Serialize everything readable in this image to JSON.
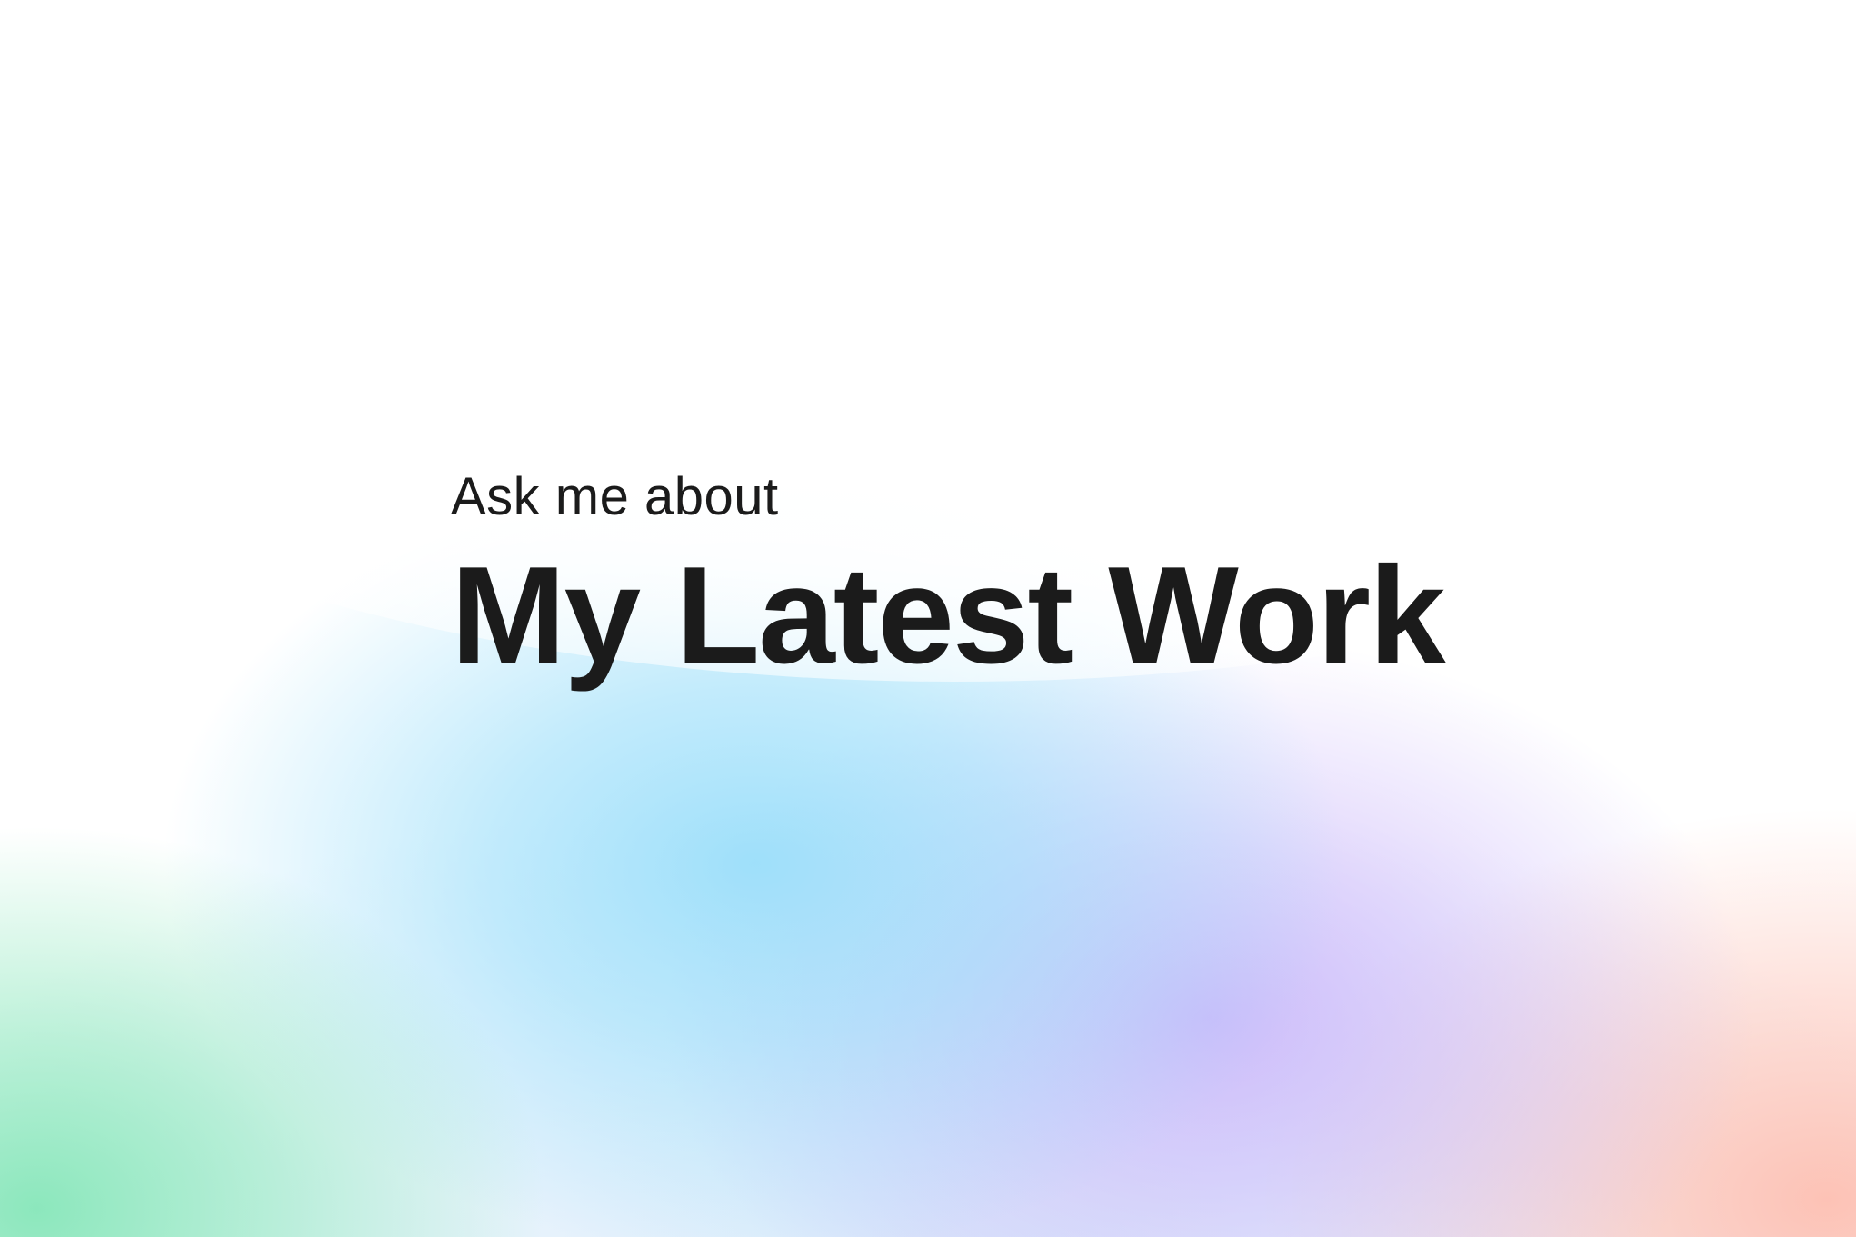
{
  "hero": {
    "eyebrow": "Ask me about",
    "title": "My Latest Work"
  },
  "colors": {
    "text": "#1b1b1b",
    "background": "#ffffff",
    "gradient_green": "#86e6b9",
    "gradient_blue": "#9adefa",
    "gradient_purple": "#cbb8fa",
    "gradient_peach": "#fdc1b4"
  }
}
